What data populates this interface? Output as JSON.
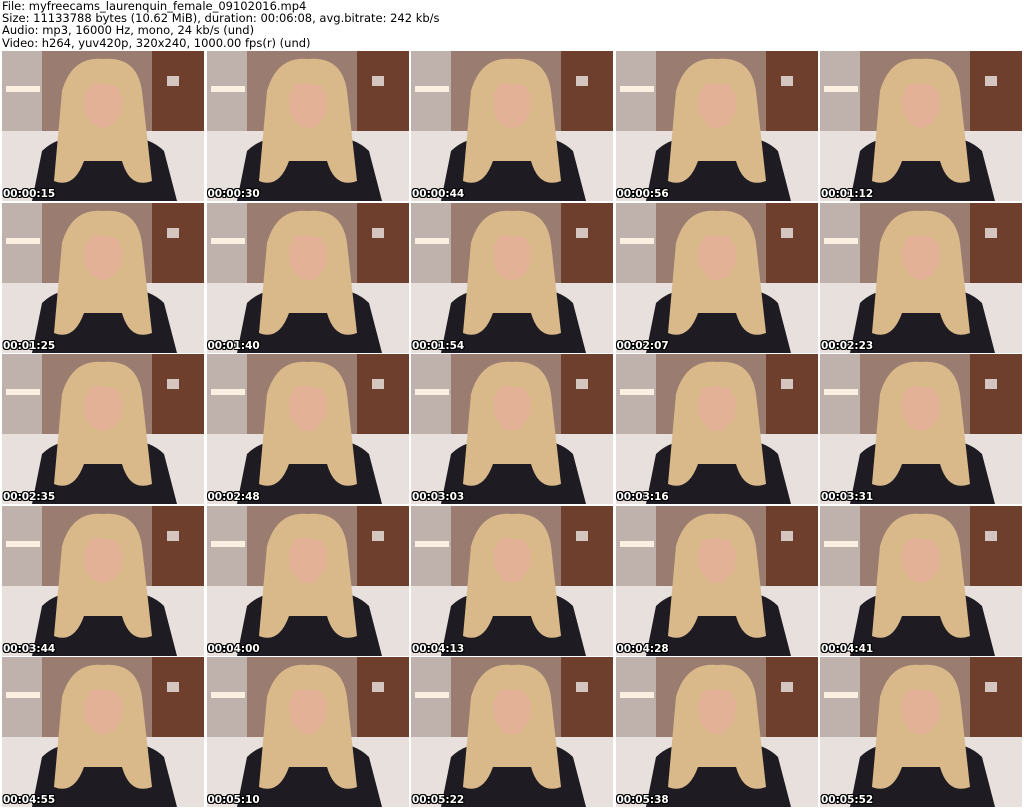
{
  "header": {
    "file": "File: myfreecams_laurenquin_female_09102016.mp4",
    "size": "Size: 11133788 bytes (10.62 MiB), duration: 00:06:08, avg.bitrate: 242 kb/s",
    "audio": "Audio: mp3, 16000 Hz, mono, 24 kb/s (und)",
    "video": "Video: h264, yuv420p, 320x240, 1000.00 fps(r) (und)"
  },
  "thumbnails": [
    {
      "timestamp": "00:00:15"
    },
    {
      "timestamp": "00:00:30"
    },
    {
      "timestamp": "00:00:44"
    },
    {
      "timestamp": "00:00:56"
    },
    {
      "timestamp": "00:01:12"
    },
    {
      "timestamp": "00:01:25"
    },
    {
      "timestamp": "00:01:40"
    },
    {
      "timestamp": "00:01:54"
    },
    {
      "timestamp": "00:02:07"
    },
    {
      "timestamp": "00:02:23"
    },
    {
      "timestamp": "00:02:35"
    },
    {
      "timestamp": "00:02:48"
    },
    {
      "timestamp": "00:03:03"
    },
    {
      "timestamp": "00:03:16"
    },
    {
      "timestamp": "00:03:31"
    },
    {
      "timestamp": "00:03:44"
    },
    {
      "timestamp": "00:04:00"
    },
    {
      "timestamp": "00:04:13"
    },
    {
      "timestamp": "00:04:28"
    },
    {
      "timestamp": "00:04:41"
    },
    {
      "timestamp": "00:04:55"
    },
    {
      "timestamp": "00:05:10"
    },
    {
      "timestamp": "00:05:22"
    },
    {
      "timestamp": "00:05:38"
    },
    {
      "timestamp": "00:05:52"
    }
  ],
  "colors": {
    "background": "#ffffff",
    "wall": "#9a7d70",
    "door": "#6e3f2c",
    "bed": "#e8e0dc",
    "hair": "#d9b98a",
    "top": "#1e1c22",
    "skin": "#e2b196"
  }
}
